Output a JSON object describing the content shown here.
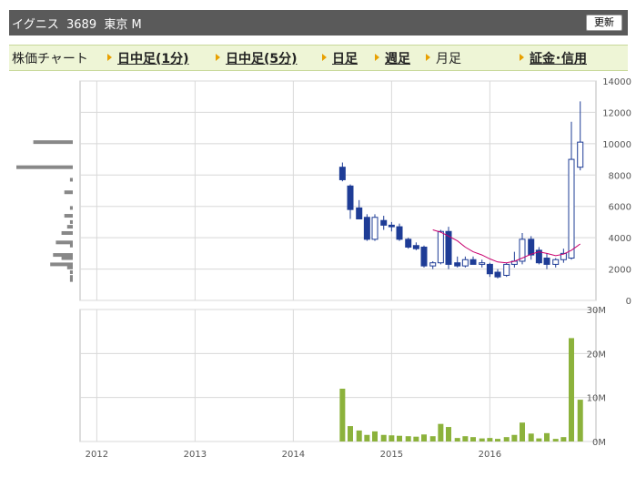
{
  "header": {
    "title": "イグニス  3689  東京 M",
    "update_label": "更新"
  },
  "nav": {
    "items": [
      {
        "label": "株価チャート",
        "link": false
      },
      {
        "label": "日中足(1分)",
        "link": true
      },
      {
        "label": "日中足(5分)",
        "link": true
      },
      {
        "label": "日足",
        "link": true
      },
      {
        "label": "週足",
        "link": true
      },
      {
        "label": "月足",
        "link": false
      },
      {
        "label": "証金･信用",
        "link": true
      }
    ]
  },
  "chart_data": {
    "type": "candlestick",
    "x_ticks": [
      "2012",
      "2013",
      "2014",
      "2015",
      "2016"
    ],
    "price_axis": {
      "ticks": [
        "0",
        "2000",
        "4000",
        "6000",
        "8000",
        "10000",
        "12000",
        "14000"
      ],
      "ylim": [
        0,
        14000
      ]
    },
    "volume_axis": {
      "ticks": [
        "0M",
        "10M",
        "20M",
        "30M"
      ],
      "ylim": [
        0,
        30
      ]
    },
    "candles": [
      {
        "t": 2014.5,
        "o": 8500,
        "h": 8800,
        "l": 7600,
        "c": 7700
      },
      {
        "t": 2014.58,
        "o": 7300,
        "h": 7400,
        "l": 5200,
        "c": 5800
      },
      {
        "t": 2014.67,
        "o": 5900,
        "h": 6400,
        "l": 5300,
        "c": 5200
      },
      {
        "t": 2014.75,
        "o": 5300,
        "h": 5500,
        "l": 3800,
        "c": 3900
      },
      {
        "t": 2014.83,
        "o": 3900,
        "h": 5500,
        "l": 3800,
        "c": 5300
      },
      {
        "t": 2014.92,
        "o": 5100,
        "h": 5400,
        "l": 4500,
        "c": 4800
      },
      {
        "t": 2015.0,
        "o": 4800,
        "h": 5000,
        "l": 4400,
        "c": 4700
      },
      {
        "t": 2015.08,
        "o": 4700,
        "h": 4900,
        "l": 3800,
        "c": 3900
      },
      {
        "t": 2015.17,
        "o": 3900,
        "h": 4000,
        "l": 3300,
        "c": 3400
      },
      {
        "t": 2015.25,
        "o": 3500,
        "h": 3700,
        "l": 3200,
        "c": 3300
      },
      {
        "t": 2015.33,
        "o": 3400,
        "h": 3500,
        "l": 2100,
        "c": 2200
      },
      {
        "t": 2015.42,
        "o": 2200,
        "h": 2500,
        "l": 2000,
        "c": 2400
      },
      {
        "t": 2015.5,
        "o": 2400,
        "h": 4500,
        "l": 2300,
        "c": 4400
      },
      {
        "t": 2015.58,
        "o": 4400,
        "h": 4700,
        "l": 2000,
        "c": 2300
      },
      {
        "t": 2015.67,
        "o": 2400,
        "h": 2800,
        "l": 2100,
        "c": 2200
      },
      {
        "t": 2015.75,
        "o": 2200,
        "h": 2800,
        "l": 2100,
        "c": 2600
      },
      {
        "t": 2015.83,
        "o": 2600,
        "h": 2800,
        "l": 2300,
        "c": 2300
      },
      {
        "t": 2015.92,
        "o": 2300,
        "h": 2600,
        "l": 2100,
        "c": 2400
      },
      {
        "t": 2016.0,
        "o": 2300,
        "h": 2400,
        "l": 1500,
        "c": 1700
      },
      {
        "t": 2016.08,
        "o": 1800,
        "h": 2000,
        "l": 1400,
        "c": 1500
      },
      {
        "t": 2016.17,
        "o": 1600,
        "h": 2400,
        "l": 1500,
        "c": 2300
      },
      {
        "t": 2016.25,
        "o": 2300,
        "h": 3100,
        "l": 2100,
        "c": 2500
      },
      {
        "t": 2016.33,
        "o": 2500,
        "h": 4300,
        "l": 2300,
        "c": 3900
      },
      {
        "t": 2016.42,
        "o": 3900,
        "h": 4100,
        "l": 2600,
        "c": 2900
      },
      {
        "t": 2016.5,
        "o": 3200,
        "h": 3400,
        "l": 2300,
        "c": 2400
      },
      {
        "t": 2016.58,
        "o": 2700,
        "h": 3000,
        "l": 2000,
        "c": 2300
      },
      {
        "t": 2016.67,
        "o": 2300,
        "h": 2700,
        "l": 2100,
        "c": 2600
      },
      {
        "t": 2016.75,
        "o": 2600,
        "h": 3300,
        "l": 2400,
        "c": 3000
      },
      {
        "t": 2016.83,
        "o": 2700,
        "h": 11400,
        "l": 2600,
        "c": 9000
      },
      {
        "t": 2016.92,
        "o": 8500,
        "h": 12700,
        "l": 8300,
        "c": 10100
      }
    ],
    "moving_average": [
      {
        "t": 2015.42,
        "v": 4500
      },
      {
        "t": 2015.5,
        "v": 4350
      },
      {
        "t": 2015.58,
        "v": 4100
      },
      {
        "t": 2015.67,
        "v": 3800
      },
      {
        "t": 2015.75,
        "v": 3400
      },
      {
        "t": 2015.83,
        "v": 3100
      },
      {
        "t": 2015.92,
        "v": 2900
      },
      {
        "t": 2016.0,
        "v": 2650
      },
      {
        "t": 2016.08,
        "v": 2450
      },
      {
        "t": 2016.17,
        "v": 2400
      },
      {
        "t": 2016.25,
        "v": 2500
      },
      {
        "t": 2016.33,
        "v": 2700
      },
      {
        "t": 2016.42,
        "v": 2950
      },
      {
        "t": 2016.5,
        "v": 3100
      },
      {
        "t": 2016.58,
        "v": 3000
      },
      {
        "t": 2016.67,
        "v": 2850
      },
      {
        "t": 2016.75,
        "v": 2950
      },
      {
        "t": 2016.83,
        "v": 3200
      },
      {
        "t": 2016.92,
        "v": 3600
      }
    ],
    "volume": [
      {
        "t": 2014.5,
        "v": 12
      },
      {
        "t": 2014.58,
        "v": 3.5
      },
      {
        "t": 2014.67,
        "v": 2.5
      },
      {
        "t": 2014.75,
        "v": 1.5
      },
      {
        "t": 2014.83,
        "v": 2.3
      },
      {
        "t": 2014.92,
        "v": 1.5
      },
      {
        "t": 2015.0,
        "v": 1.4
      },
      {
        "t": 2015.08,
        "v": 1.3
      },
      {
        "t": 2015.17,
        "v": 1.2
      },
      {
        "t": 2015.25,
        "v": 1.1
      },
      {
        "t": 2015.33,
        "v": 1.6
      },
      {
        "t": 2015.42,
        "v": 1.2
      },
      {
        "t": 2015.5,
        "v": 4.0
      },
      {
        "t": 2015.58,
        "v": 3.3
      },
      {
        "t": 2015.67,
        "v": 0.8
      },
      {
        "t": 2015.75,
        "v": 1.2
      },
      {
        "t": 2015.83,
        "v": 1.0
      },
      {
        "t": 2015.92,
        "v": 0.7
      },
      {
        "t": 2016.0,
        "v": 0.8
      },
      {
        "t": 2016.08,
        "v": 0.6
      },
      {
        "t": 2016.17,
        "v": 1.0
      },
      {
        "t": 2016.25,
        "v": 1.5
      },
      {
        "t": 2016.33,
        "v": 4.3
      },
      {
        "t": 2016.42,
        "v": 1.8
      },
      {
        "t": 2016.5,
        "v": 0.7
      },
      {
        "t": 2016.58,
        "v": 1.9
      },
      {
        "t": 2016.67,
        "v": 0.6
      },
      {
        "t": 2016.75,
        "v": 1.0
      },
      {
        "t": 2016.83,
        "v": 23.5
      },
      {
        "t": 2016.92,
        "v": 9.5
      }
    ],
    "price_profile": [
      {
        "price": 10100,
        "w": 0.7
      },
      {
        "price": 8500,
        "w": 1.0
      },
      {
        "price": 7700,
        "w": 0.05
      },
      {
        "price": 6900,
        "w": 0.15
      },
      {
        "price": 5900,
        "w": 0.05
      },
      {
        "price": 5400,
        "w": 0.15
      },
      {
        "price": 5000,
        "w": 0.05
      },
      {
        "price": 4700,
        "w": 0.1
      },
      {
        "price": 4300,
        "w": 0.2
      },
      {
        "price": 3700,
        "w": 0.3
      },
      {
        "price": 3500,
        "w": 0.05
      },
      {
        "price": 2900,
        "w": 0.35
      },
      {
        "price": 2700,
        "w": 0.2
      },
      {
        "price": 2300,
        "w": 0.4
      },
      {
        "price": 2100,
        "w": 0.1
      },
      {
        "price": 1800,
        "w": 0.05
      },
      {
        "price": 1500,
        "w": 0.05
      },
      {
        "price": 1300,
        "w": 0.05
      }
    ],
    "colors": {
      "up": "#ffffff",
      "down": "#1e3c96",
      "ma": "#c8006e",
      "volume": "#8cb23c",
      "profile": "#888888",
      "grid": "#d8d8d8"
    }
  }
}
